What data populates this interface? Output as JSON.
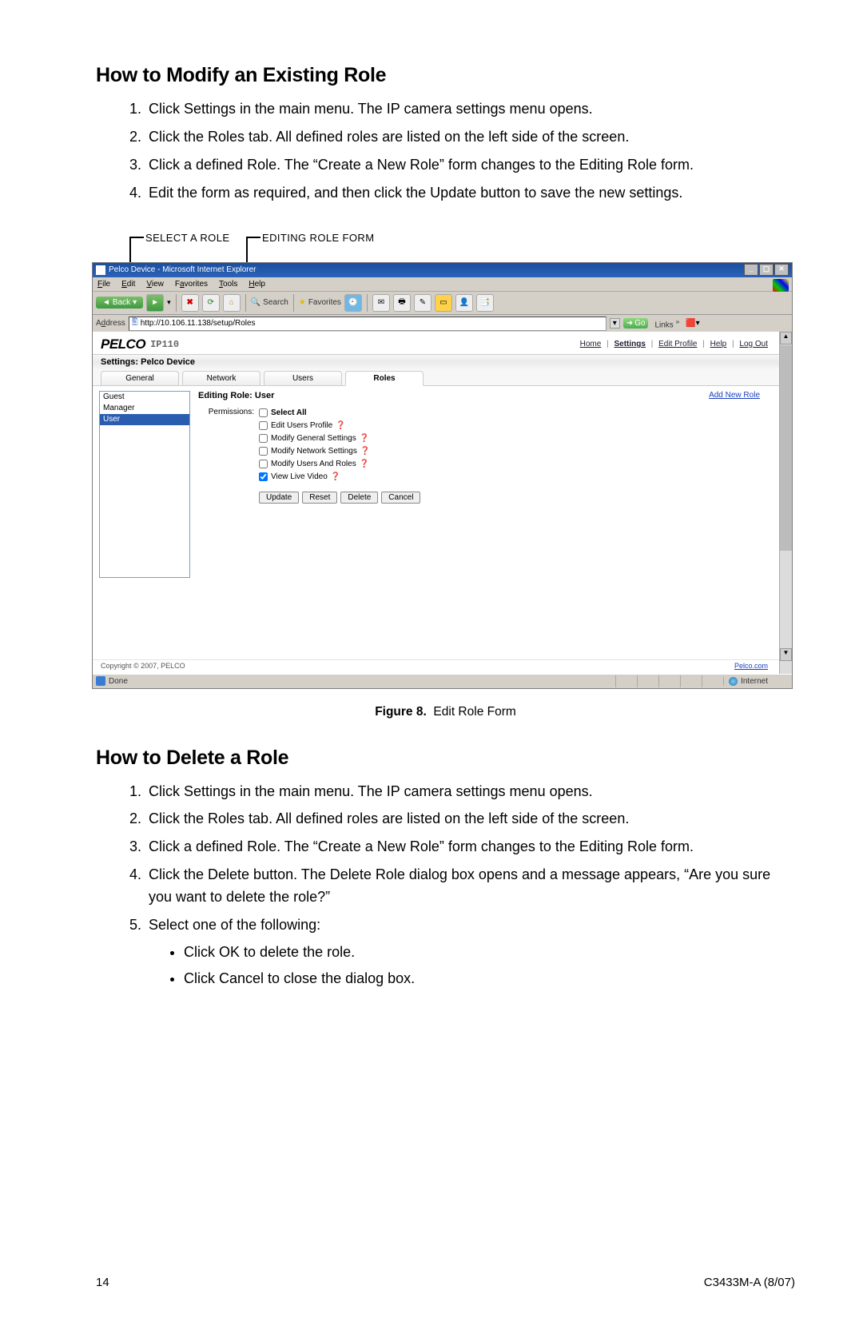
{
  "section1": {
    "heading": "How to Modify an Existing Role",
    "steps": [
      "Click Settings in the main menu. The IP camera settings menu opens.",
      "Click the Roles tab. All defined roles are listed on the left side of the screen.",
      "Click a defined Role. The “Create a New Role” form changes to the Editing Role form.",
      "Edit the form as required, and then click the Update button to save the new settings."
    ]
  },
  "callouts": {
    "left": "SELECT A ROLE",
    "right": "EDITING ROLE FORM"
  },
  "screenshot": {
    "window_title": "Pelco Device - Microsoft Internet Explorer",
    "menus": [
      "File",
      "Edit",
      "View",
      "Favorites",
      "Tools",
      "Help"
    ],
    "toolbar": {
      "back": "Back",
      "search": "Search",
      "favorites": "Favorites"
    },
    "address": {
      "label": "Address",
      "url": "http://10.106.11.138/setup/Roles",
      "go": "Go",
      "links": "Links"
    },
    "app": {
      "logo": "PELCO",
      "model": "IP110",
      "top_links": {
        "home": "Home",
        "settings": "Settings",
        "edit_profile": "Edit Profile",
        "help": "Help",
        "logout": "Log Out"
      },
      "settings_title": "Settings: Pelco Device",
      "tabs": [
        "General",
        "Network",
        "Users",
        "Roles"
      ],
      "active_tab": "Roles",
      "role_list": [
        "Guest",
        "Manager",
        "User"
      ],
      "selected_role": "User",
      "form": {
        "title_prefix": "Editing Role: ",
        "title_role": "User",
        "perm_label": "Permissions:",
        "perms": [
          {
            "label": "Select All",
            "checked": false,
            "bold": true
          },
          {
            "label": "Edit Users Profile",
            "checked": false
          },
          {
            "label": "Modify General Settings",
            "checked": false
          },
          {
            "label": "Modify Network Settings",
            "checked": false
          },
          {
            "label": "Modify Users And Roles",
            "checked": false
          },
          {
            "label": "View Live Video",
            "checked": true
          }
        ],
        "buttons": [
          "Update",
          "Reset",
          "Delete",
          "Cancel"
        ],
        "add_new": "Add New Role"
      },
      "footer": {
        "copyright": "Copyright © 2007, PELCO",
        "pelco_link": "Pelco.com"
      }
    },
    "status": {
      "done": "Done",
      "internet": "Internet"
    }
  },
  "figure": {
    "label": "Figure 8.",
    "caption": "Edit Role Form"
  },
  "section2": {
    "heading": "How to Delete a Role",
    "steps": [
      "Click Settings in the main menu. The IP camera settings menu opens.",
      "Click the Roles tab. All defined roles are listed on the left side of the screen.",
      "Click a defined Role. The “Create a New Role” form changes to the Editing Role form.",
      "Click the Delete button. The Delete Role dialog box opens and a message appears, “Are you sure you want to delete the role?”",
      "Select one of the following:"
    ],
    "substeps": [
      "Click OK to delete the role.",
      "Click Cancel to close the dialog box."
    ]
  },
  "page_footer": {
    "left": "14",
    "right": "C3433M-A (8/07)"
  }
}
